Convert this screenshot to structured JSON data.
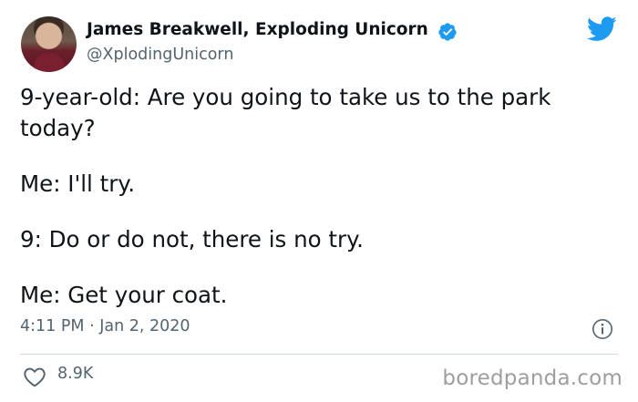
{
  "author": {
    "display_name": "James Breakwell, Exploding Unicorn",
    "handle": "@XplodingUnicorn",
    "verified": true
  },
  "tweet": {
    "lines": [
      "9-year-old: Are you going to take us to the park",
      "today?",
      "Me: I'll try.",
      "9: Do or do not, there is no try.",
      "Me: Get your coat."
    ],
    "timestamp": "4:11 PM · Jan 2, 2020",
    "likes": "8.9K"
  },
  "watermark": "boredpanda.com",
  "colors": {
    "text": "#0f1419",
    "secondary_text": "#536471",
    "twitter_blue": "#1d9bf0",
    "divider": "#cfd9de",
    "watermark": "#9e9e9e"
  },
  "icons": {
    "verified": "verified-badge-icon",
    "brand": "twitter-bird-icon",
    "info": "info-icon",
    "like": "heart-icon"
  }
}
